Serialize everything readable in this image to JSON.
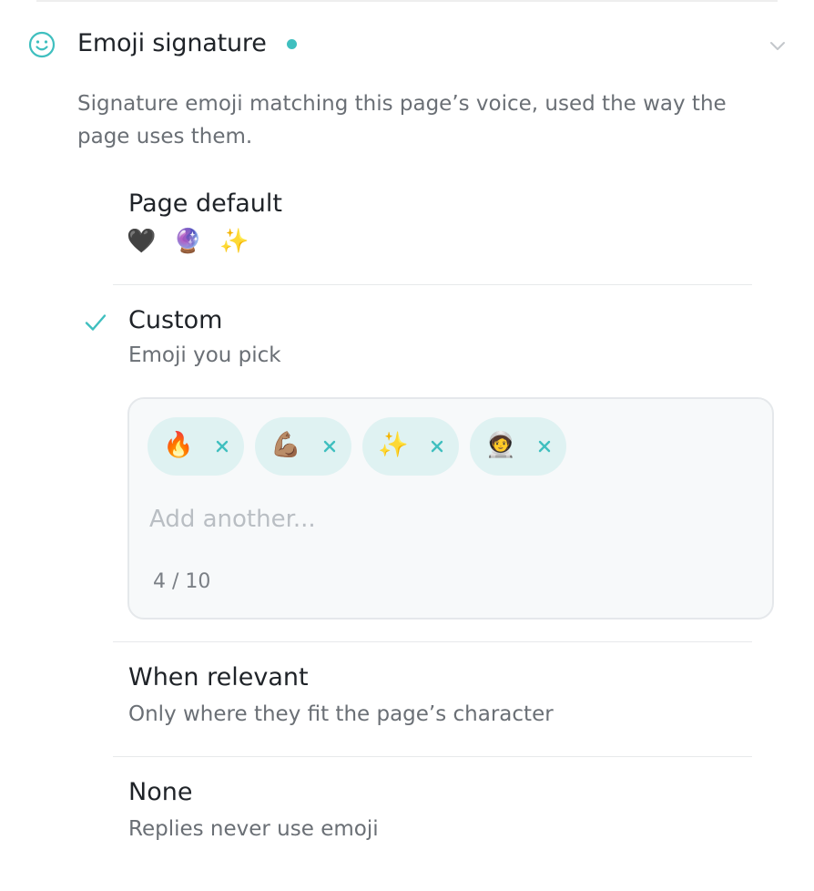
{
  "section": {
    "icon": "smile-icon",
    "title": "Emoji signature",
    "status_color": "#3fbfbf",
    "chevron": "chevron-down-icon",
    "description": "Signature emoji matching this page’s voice, used the way the page uses them."
  },
  "options": [
    {
      "id": "page-default",
      "label": "Page default",
      "emojis": [
        "🖤",
        "🔮",
        "✨"
      ],
      "selected": false
    },
    {
      "id": "custom",
      "label": "Custom",
      "description": "Emoji you pick",
      "selected": true,
      "chips": [
        {
          "emoji": "🔥",
          "remove_icon": "close-icon"
        },
        {
          "emoji": "💪🏽",
          "remove_icon": "close-icon"
        },
        {
          "emoji": "✨",
          "remove_icon": "close-icon"
        },
        {
          "emoji": "🧑‍🚀",
          "remove_icon": "close-icon"
        }
      ],
      "input_placeholder": "Add another...",
      "input_value": "",
      "counter": "4 / 10"
    },
    {
      "id": "when-relevant",
      "label": "When relevant",
      "description": "Only where they fit the page’s character",
      "selected": false
    },
    {
      "id": "none",
      "label": "None",
      "description": "Replies never use emoji",
      "selected": false
    }
  ],
  "colors": {
    "accent": "#3fbfbf",
    "chip_background": "#dff2f2",
    "box_background": "#f7f9fa",
    "muted_text": "#6a6f75"
  }
}
